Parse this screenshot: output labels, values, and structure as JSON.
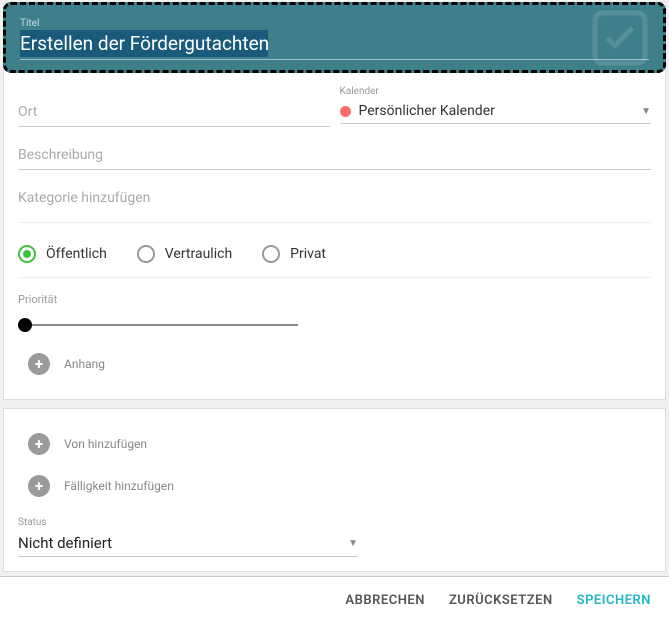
{
  "title": {
    "label": "Titel",
    "value": "Erstellen der Fördergutachten"
  },
  "location": {
    "placeholder": "Ort",
    "value": ""
  },
  "calendar": {
    "label": "Kalender",
    "selected": "Persönlicher Kalender"
  },
  "description": {
    "placeholder": "Beschreibung",
    "value": ""
  },
  "category": {
    "placeholder": "Kategorie hinzufügen"
  },
  "visibility": {
    "options": [
      {
        "label": "Öffentlich",
        "selected": true
      },
      {
        "label": "Vertraulich",
        "selected": false
      },
      {
        "label": "Privat",
        "selected": false
      }
    ]
  },
  "priority": {
    "label": "Priorität",
    "value": 0
  },
  "attachment": {
    "label": "Anhang"
  },
  "start": {
    "label": "Von hinzufügen"
  },
  "due": {
    "label": "Fälligkeit hinzufügen"
  },
  "status": {
    "label": "Status",
    "value": "Nicht definiert"
  },
  "buttons": {
    "cancel": "ABBRECHEN",
    "reset": "ZURÜCKSETZEN",
    "save": "SPEICHERN"
  }
}
